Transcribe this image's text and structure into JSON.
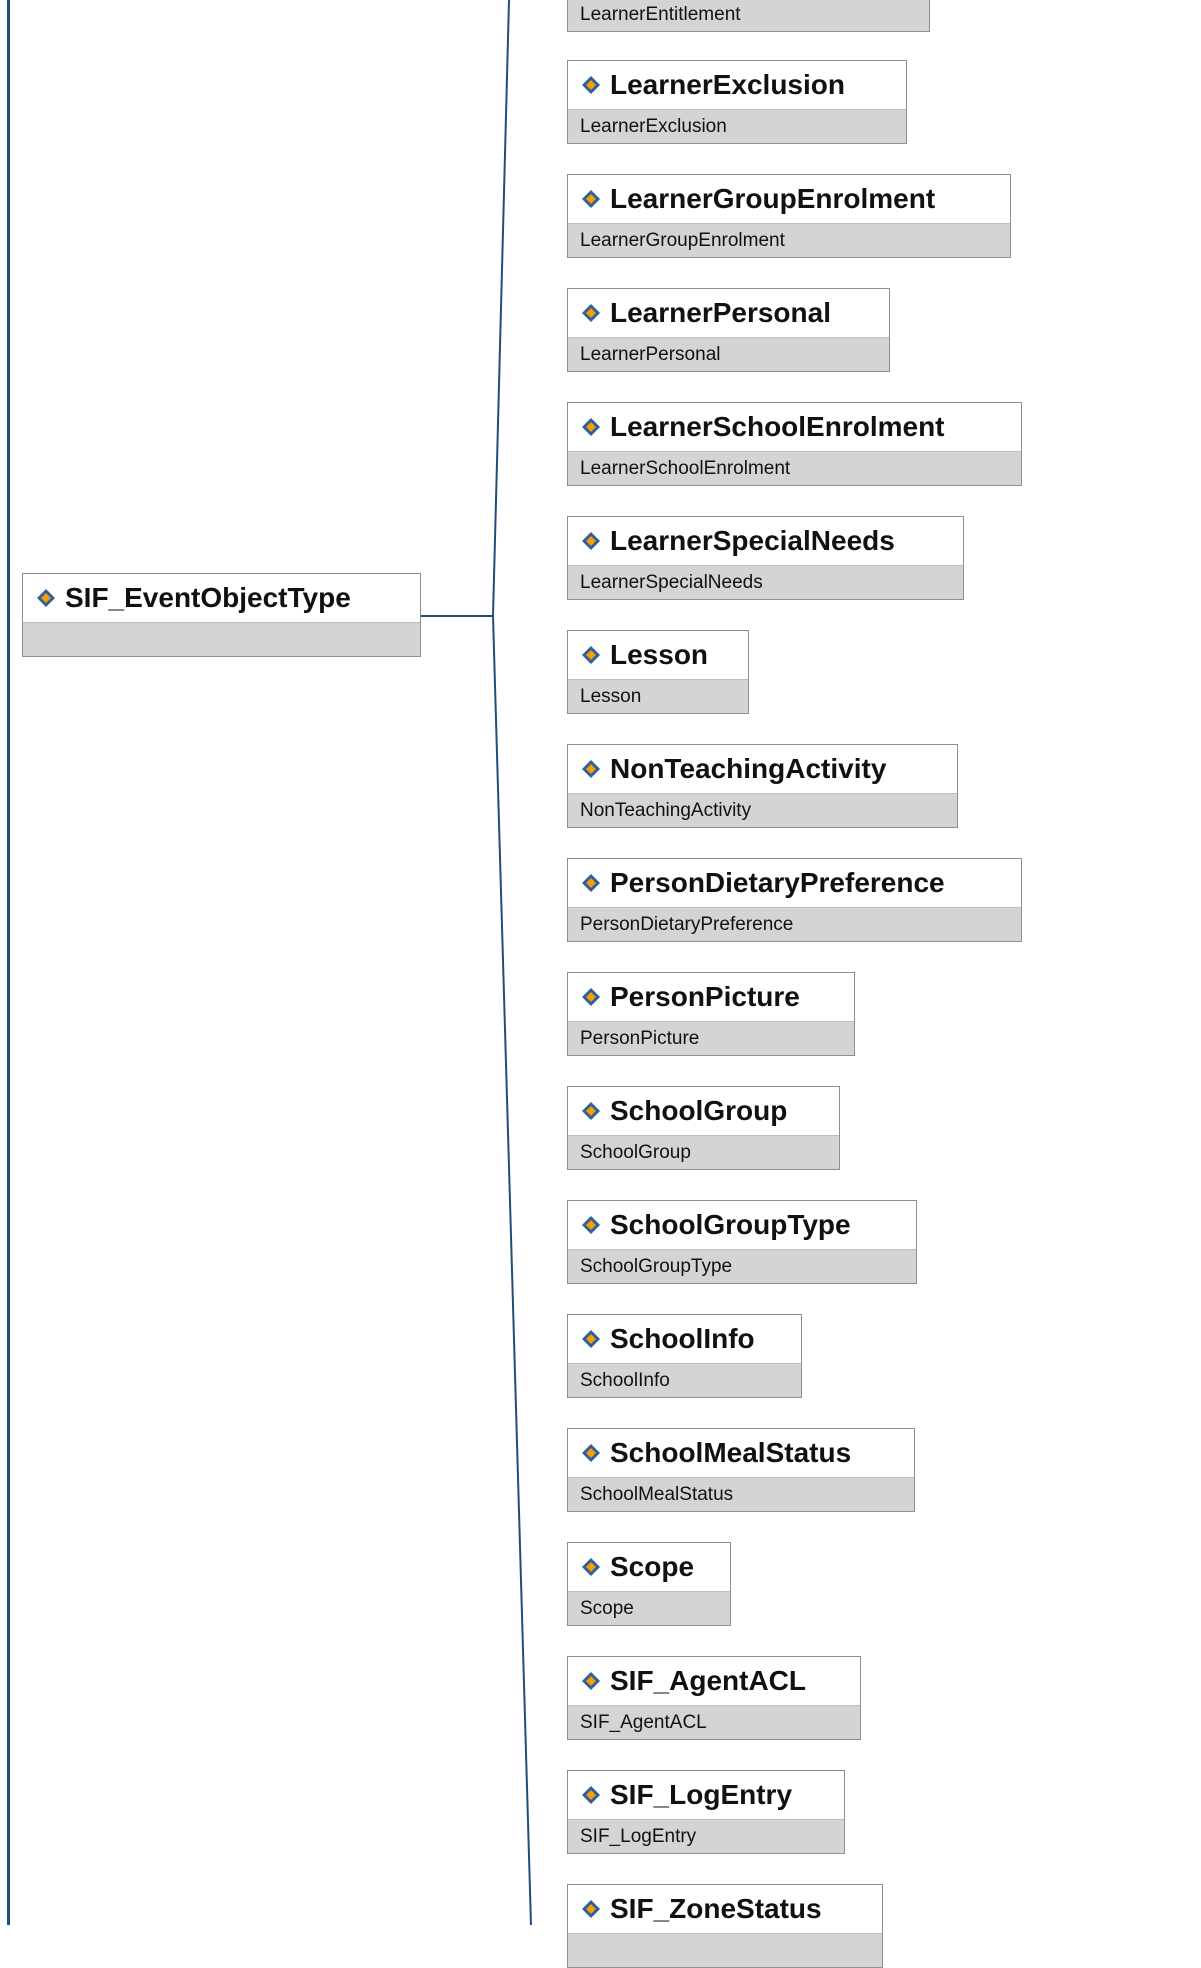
{
  "root": {
    "title": "SIF_EventObjectType",
    "subtitle": ""
  },
  "children": [
    {
      "title": "",
      "subtitle": "LearnerEntitlement"
    },
    {
      "title": "LearnerExclusion",
      "subtitle": "LearnerExclusion"
    },
    {
      "title": "LearnerGroupEnrolment",
      "subtitle": "LearnerGroupEnrolment"
    },
    {
      "title": "LearnerPersonal",
      "subtitle": "LearnerPersonal"
    },
    {
      "title": "LearnerSchoolEnrolment",
      "subtitle": "LearnerSchoolEnrolment"
    },
    {
      "title": "LearnerSpecialNeeds",
      "subtitle": "LearnerSpecialNeeds"
    },
    {
      "title": "Lesson",
      "subtitle": "Lesson"
    },
    {
      "title": "NonTeachingActivity",
      "subtitle": "NonTeachingActivity"
    },
    {
      "title": "PersonDietaryPreference",
      "subtitle": "PersonDietaryPreference"
    },
    {
      "title": "PersonPicture",
      "subtitle": "PersonPicture"
    },
    {
      "title": "SchoolGroup",
      "subtitle": "SchoolGroup"
    },
    {
      "title": "SchoolGroupType",
      "subtitle": "SchoolGroupType"
    },
    {
      "title": "SchoolInfo",
      "subtitle": "SchoolInfo"
    },
    {
      "title": "SchoolMealStatus",
      "subtitle": "SchoolMealStatus"
    },
    {
      "title": "Scope",
      "subtitle": "Scope"
    },
    {
      "title": "SIF_AgentACL",
      "subtitle": "SIF_AgentACL"
    },
    {
      "title": "SIF_LogEntry",
      "subtitle": "SIF_LogEntry"
    },
    {
      "title": "SIF_ZoneStatus",
      "subtitle": ""
    }
  ],
  "icon": "element-diamond-icon",
  "colors": {
    "line": "#1f4e79",
    "icon_blue": "#2f5fa0",
    "icon_orange": "#f0a000",
    "node_border": "#8f8f8f",
    "node_sub_bg": "#d4d4d4"
  }
}
